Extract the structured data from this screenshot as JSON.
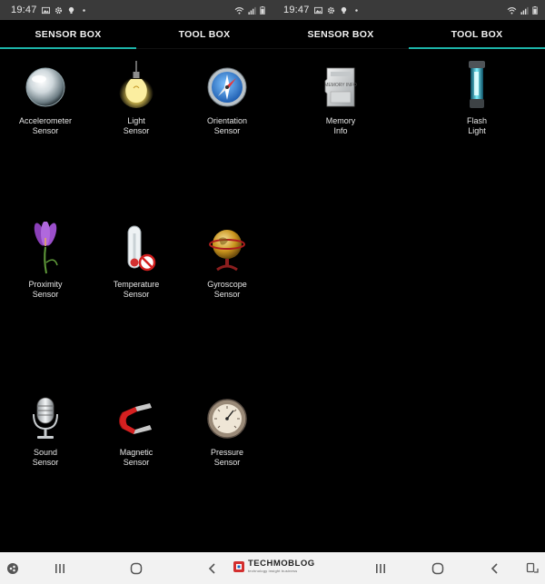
{
  "status_left": {
    "time": "19:47"
  },
  "status_right": {
    "time": "19:47"
  },
  "tabs": {
    "sensor_box": "SENSOR BOX",
    "tool_box": "TOOL BOX"
  },
  "sensors": [
    {
      "line1": "Accelerometer",
      "line2": "Sensor",
      "icon": "crystal-ball-icon"
    },
    {
      "line1": "Light",
      "line2": "Sensor",
      "icon": "light-bulb-icon"
    },
    {
      "line1": "Orientation",
      "line2": "Sensor",
      "icon": "compass-icon"
    },
    {
      "line1": "Proximity",
      "line2": "Sensor",
      "icon": "flower-icon"
    },
    {
      "line1": "Temperature",
      "line2": "Sensor",
      "icon": "thermometer-icon"
    },
    {
      "line1": "Gyroscope",
      "line2": "Sensor",
      "icon": "globe-icon"
    },
    {
      "line1": "Sound",
      "line2": "Sensor",
      "icon": "microphone-icon"
    },
    {
      "line1": "Magnetic",
      "line2": "Sensor",
      "icon": "magnet-icon"
    },
    {
      "line1": "Pressure",
      "line2": "Sensor",
      "icon": "barometer-icon"
    }
  ],
  "tools": [
    {
      "line1": "Memory",
      "line2": "Info",
      "icon": "memory-card-icon"
    },
    {
      "line1": "Flash",
      "line2": "Light",
      "icon": "flashlight-icon"
    }
  ],
  "memory_card_text": "MEMORY INFO",
  "watermark": {
    "brand": "TECHMOBLOG",
    "tagline": "technology insight business"
  },
  "colors": {
    "accent": "#1cb3a8",
    "statusbar": "#3a3a3a",
    "navbar": "#f2f2f2",
    "background": "#000000"
  }
}
